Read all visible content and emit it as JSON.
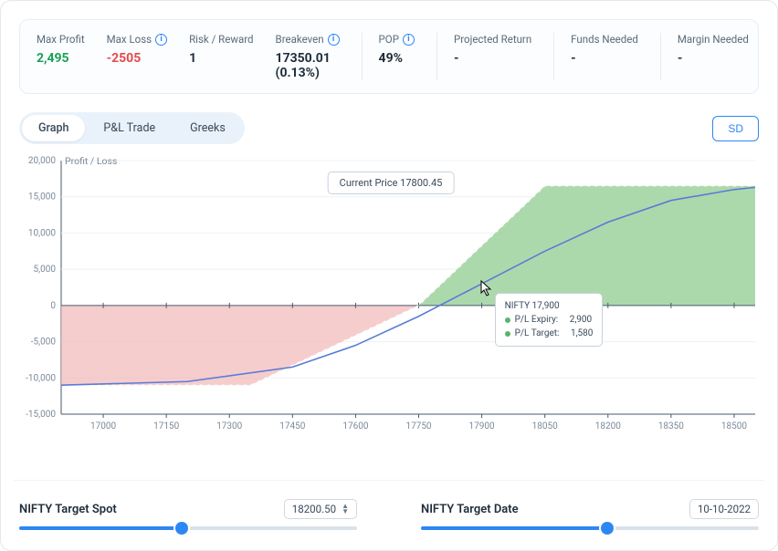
{
  "metrics": {
    "max_profit": {
      "label": "Max Profit",
      "value": "2,495"
    },
    "max_loss": {
      "label": "Max Loss",
      "value": "-2505"
    },
    "risk_reward": {
      "label": "Risk / Reward",
      "value": "1"
    },
    "breakeven": {
      "label": "Breakeven",
      "value": "17350.01 (0.13%)"
    },
    "pop": {
      "label": "POP",
      "value": "49%"
    },
    "proj_return": {
      "label": "Projected Return",
      "value": "-"
    },
    "funds": {
      "label": "Funds Needed",
      "value": "-"
    },
    "margin": {
      "label": "Margin Needed",
      "value": "-"
    }
  },
  "tabs": {
    "graph": "Graph",
    "pnl": "P&L Trade",
    "greeks": "Greeks"
  },
  "sd_button": "SD",
  "chart": {
    "ylabel": "Profit / Loss",
    "current_price": "Current Price 17800.45",
    "tooltip": {
      "underlying": "NIFTY  17,900",
      "pl_expiry_label": "P/L Expiry:",
      "pl_expiry_value": "2,900",
      "pl_target_label": "P/L Target:",
      "pl_target_value": "1,580"
    }
  },
  "sliders": {
    "spot": {
      "label": "NIFTY Target Spot",
      "value": "18200.50",
      "pos_pct": 48
    },
    "date": {
      "label": "NIFTY Target Date",
      "value": "10-10-2022",
      "pos_pct": 55
    }
  },
  "chart_data": {
    "type": "line",
    "xlabel": "",
    "ylabel": "Profit / Loss",
    "xlim": [
      16900,
      18550
    ],
    "ylim": [
      -15000,
      20000
    ],
    "x_ticks": [
      17000,
      17150,
      17300,
      17450,
      17600,
      17750,
      17900,
      18050,
      18200,
      18350,
      18500
    ],
    "y_ticks": [
      -15000,
      -10000,
      -5000,
      0,
      5000,
      10000,
      15000,
      20000
    ],
    "series": [
      {
        "name": "P/L Expiry",
        "type": "area",
        "color_pos": "#8dcb90",
        "color_neg": "#f0b4b4",
        "points": [
          [
            16900,
            -11000
          ],
          [
            17350,
            -11000
          ],
          [
            17750,
            0
          ],
          [
            18050,
            16500
          ],
          [
            18550,
            16500
          ]
        ]
      },
      {
        "name": "P/L Target",
        "type": "line",
        "color": "#5a7bd6",
        "points": [
          [
            16900,
            -11000
          ],
          [
            17200,
            -10500
          ],
          [
            17450,
            -8500
          ],
          [
            17600,
            -5500
          ],
          [
            17750,
            -1500
          ],
          [
            17900,
            3000
          ],
          [
            18050,
            7500
          ],
          [
            18200,
            11500
          ],
          [
            18350,
            14500
          ],
          [
            18500,
            16000
          ],
          [
            18550,
            16300
          ]
        ]
      }
    ],
    "annotations": {
      "current_price": 17800.45,
      "breakeven_x": 17750,
      "hover_x": 17900,
      "hover": {
        "underlying": "NIFTY",
        "x": 17900,
        "pl_expiry": 2900,
        "pl_target": 1580
      }
    }
  }
}
